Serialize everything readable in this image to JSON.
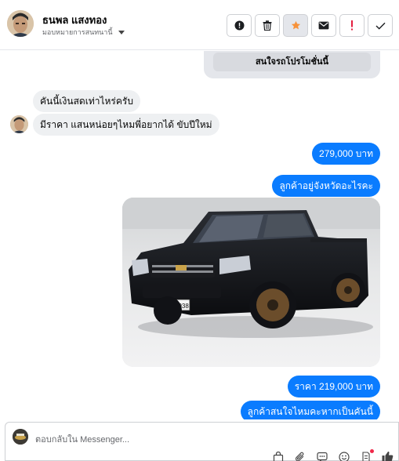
{
  "header": {
    "contact_name": "ธนพล แสงทอง",
    "assign_label": "มอบหมายการสนทนานี้",
    "actions": [
      {
        "icon": "alert-circle-icon"
      },
      {
        "icon": "trash-icon"
      },
      {
        "icon": "star-icon",
        "color": "#f7923a"
      },
      {
        "icon": "mail-icon"
      },
      {
        "icon": "exclamation-icon",
        "color": "#e41e3f"
      },
      {
        "icon": "checkmark-icon"
      }
    ]
  },
  "messages": {
    "card_button": "สนใจรถโปรโมชั่นนี้",
    "m1": "คันนี้เงินสดเท่าไหร่ครับ",
    "m2": "มีราคา แสนหน่อยๆไหมพี่อยากได้ ขับปีใหม่",
    "m3": "279,000 บาท",
    "m4": "ลูกค้าอยู่จังหวัดอะไรคะ",
    "plate_text": "ฆฟ 1938",
    "m5": "ราคา 219,000 บาท",
    "m6": "ลูกค้าสนใจไหมคะหากเป็นคันนี้"
  },
  "composer": {
    "placeholder": "ตอบกลับใน Messenger...",
    "tools": [
      "bag-icon",
      "attachment-icon",
      "saved-reply-icon",
      "emoji-icon",
      "typing-icon",
      "like-icon"
    ]
  },
  "colors": {
    "accent_blue": "#0a7cff",
    "incoming_bubble": "#eef0f2"
  }
}
